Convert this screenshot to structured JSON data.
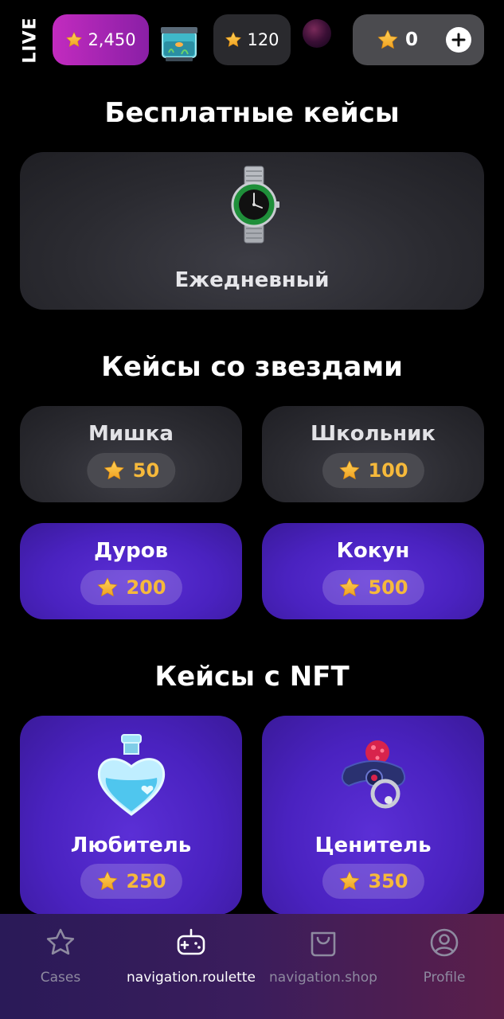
{
  "topbar": {
    "live_label": "LIVE",
    "feed": [
      {
        "type": "win",
        "amount": "2,450",
        "icon": "star-icon",
        "color": "#c22bbf"
      },
      {
        "type": "gift",
        "icon": "aquarium-icon"
      },
      {
        "type": "win",
        "amount": "120",
        "icon": "star-icon"
      },
      {
        "type": "gift",
        "icon": "orb-icon"
      }
    ],
    "balance": {
      "value": "0",
      "icon": "star-icon",
      "add_icon": "plus-icon"
    }
  },
  "sections": {
    "free": {
      "title": "Бесплатные кейсы",
      "cases": [
        {
          "name": "Ежедневный",
          "icon": "watch-icon"
        }
      ]
    },
    "stars": {
      "title": "Кейсы со звездами",
      "cases": [
        {
          "name": "Мишка",
          "price": "50",
          "style": "gray"
        },
        {
          "name": "Школьник",
          "price": "100",
          "style": "gray"
        },
        {
          "name": "Дуров",
          "price": "200",
          "style": "purple"
        },
        {
          "name": "Кокун",
          "price": "500",
          "style": "purple"
        }
      ]
    },
    "nft": {
      "title": "Кейсы с NFT",
      "cases": [
        {
          "name": "Любитель",
          "price": "250",
          "icon": "love-potion-icon"
        },
        {
          "name": "Ценитель",
          "price": "350",
          "icon": "pacifier-icon"
        }
      ]
    }
  },
  "nav": {
    "items": [
      {
        "label": "Cases",
        "icon": "star-outline-icon",
        "active": false
      },
      {
        "label": "navigation.roulette",
        "icon": "gamepad-icon",
        "active": true
      },
      {
        "label": "navigation.shop",
        "icon": "shopping-bag-icon",
        "active": false
      },
      {
        "label": "Profile",
        "icon": "user-circle-icon",
        "active": false
      }
    ]
  },
  "colors": {
    "background": "#000000",
    "star": "#f6b93b",
    "purple_card": "#4a22c0",
    "gray_card": "#2b2b31",
    "accent_magenta": "#c22bbf"
  }
}
